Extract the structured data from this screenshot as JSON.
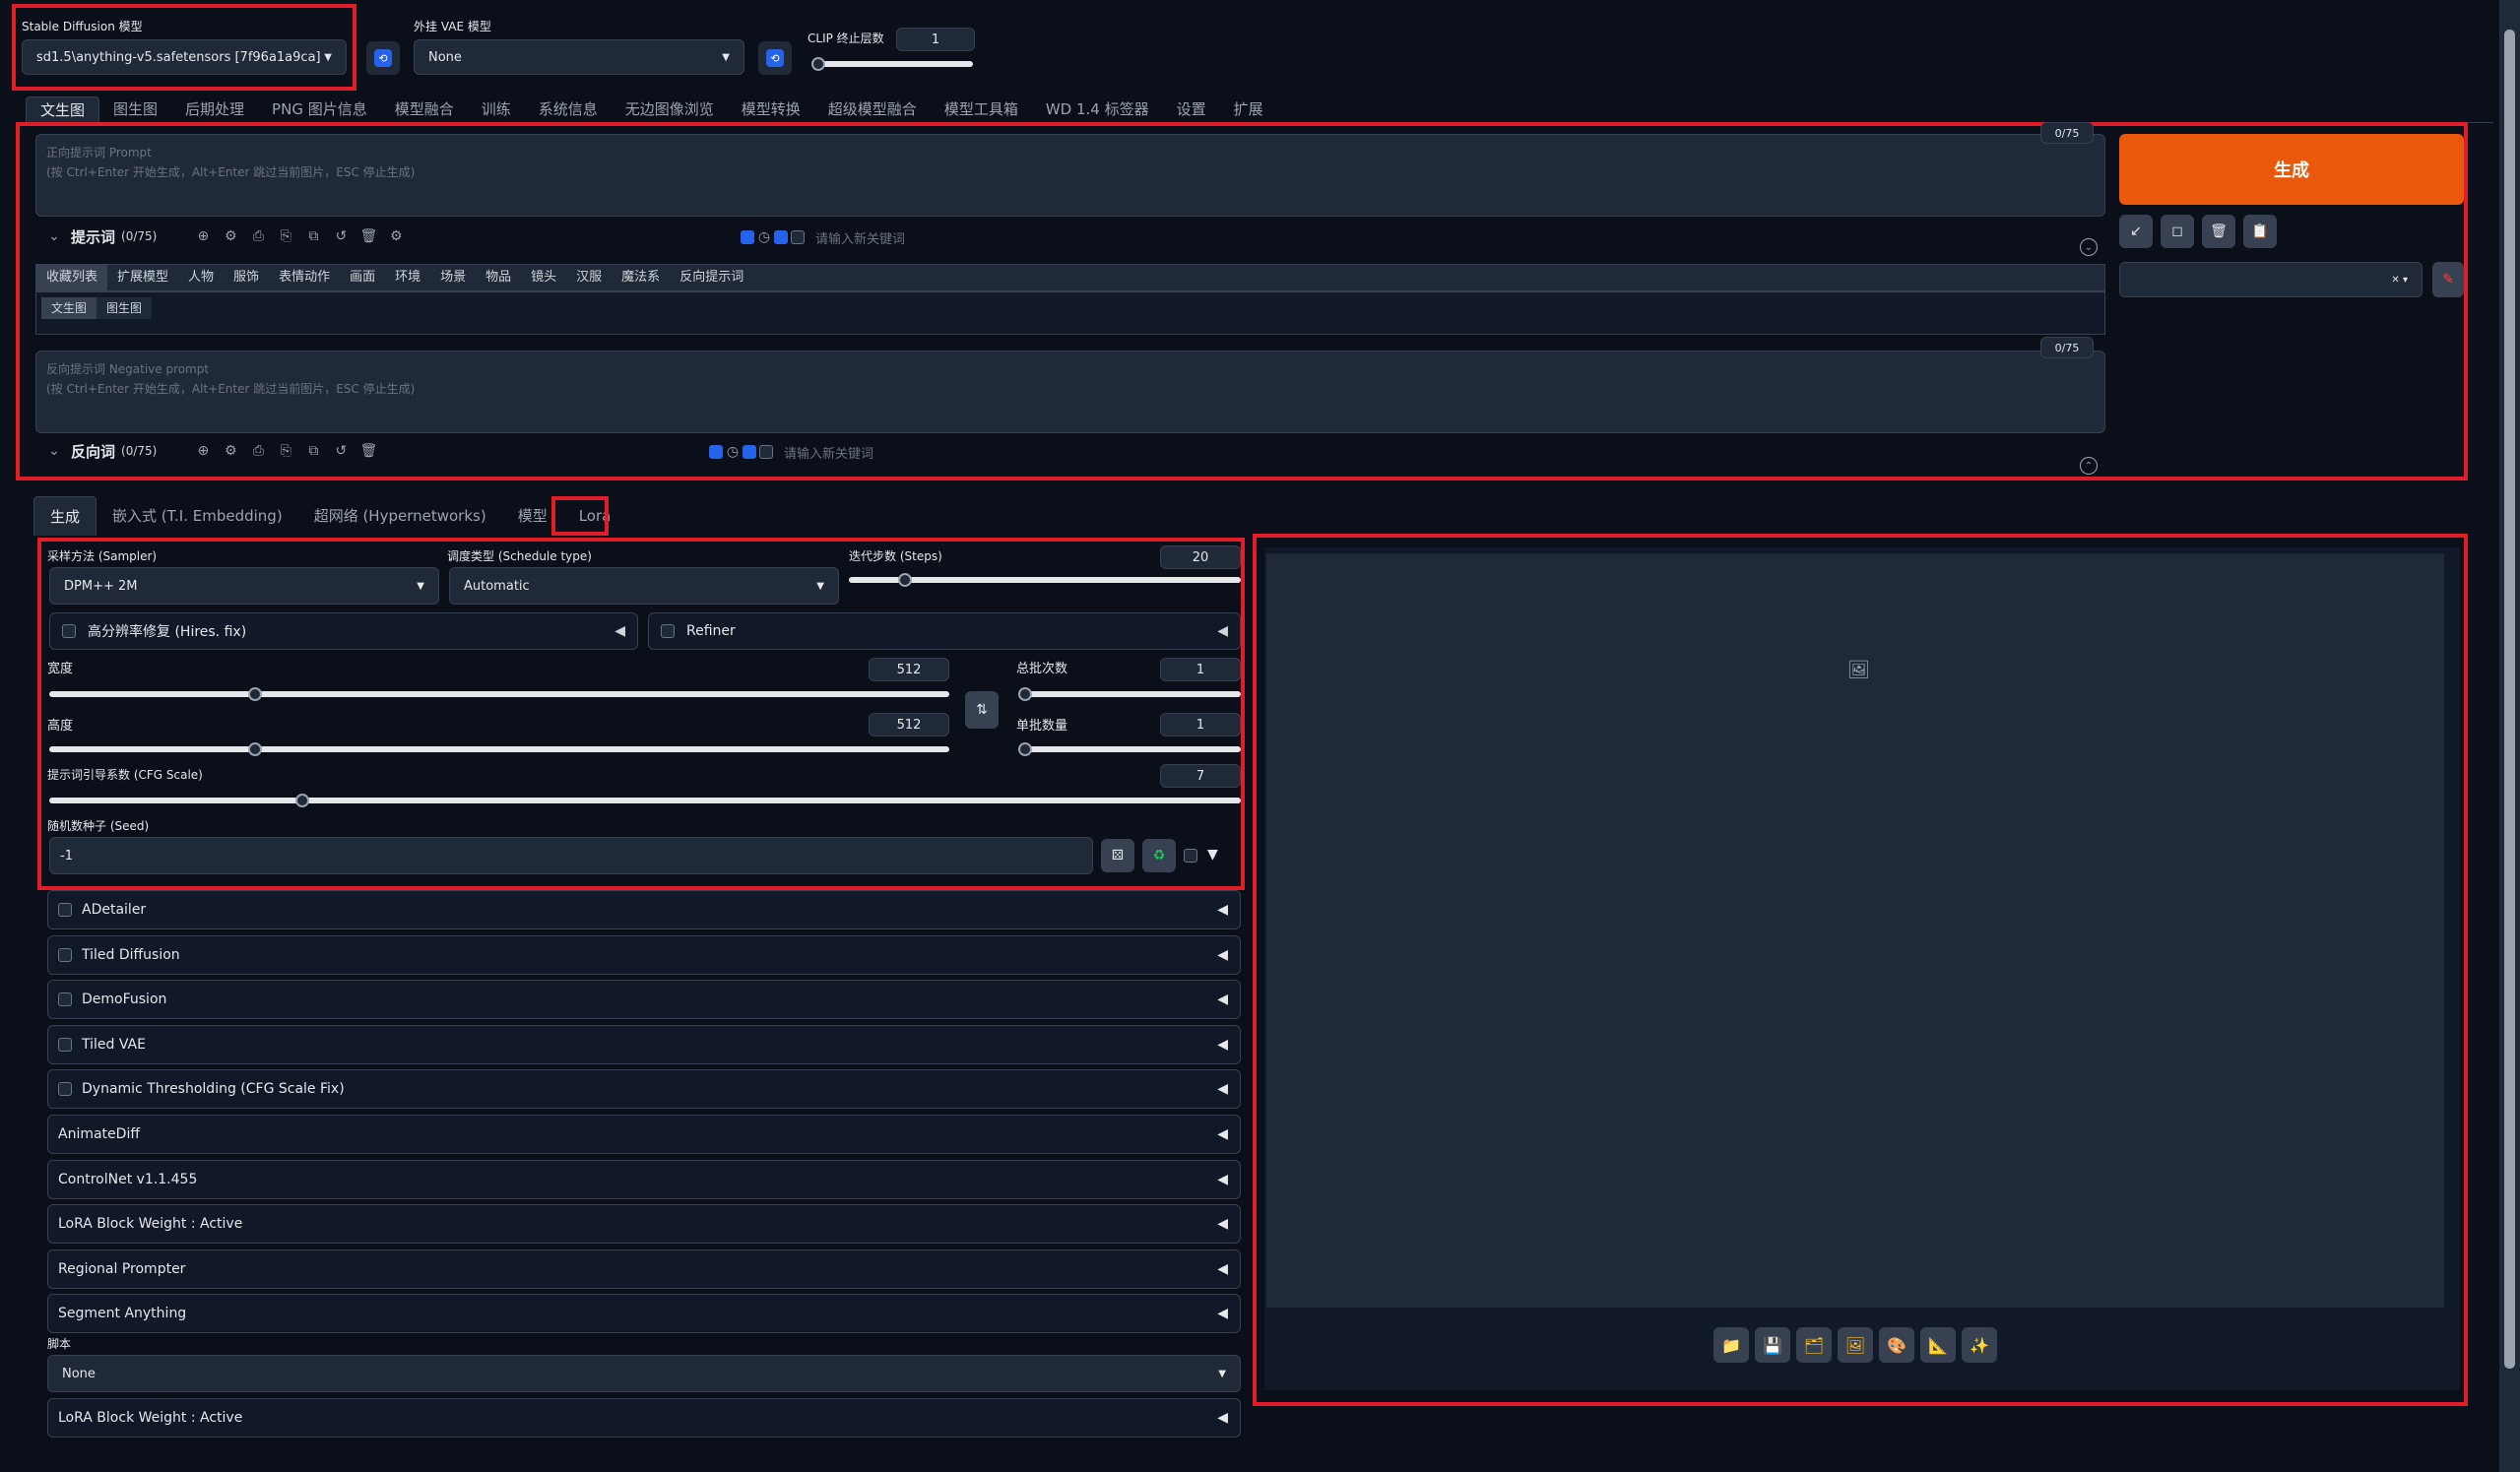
{
  "top": {
    "sd_model_label": "Stable Diffusion 模型",
    "sd_model_value": "sd1.5\\anything-v5.safetensors [7f96a1a9ca]",
    "vae_label": "外挂 VAE 模型",
    "vae_value": "None",
    "clip_label": "CLIP 终止层数",
    "clip_value": "1"
  },
  "main_tabs": [
    "文生图",
    "图生图",
    "后期处理",
    "PNG 图片信息",
    "模型融合",
    "训练",
    "系统信息",
    "无边图像浏览",
    "模型转换",
    "超级模型融合",
    "模型工具箱",
    "WD 1.4 标签器",
    "设置",
    "扩展"
  ],
  "prompt": {
    "counter": "0/75",
    "placeholder_line1": "正向提示词 Prompt",
    "placeholder_line2": "(按 Ctrl+Enter 开始生成，Alt+Enter 跳过当前图片，ESC 停止生成)",
    "toolbar_label": "提示词",
    "toolbar_count": "(0/75)",
    "keyword_placeholder": "请输入新关键词"
  },
  "categories": [
    "收藏列表",
    "扩展模型",
    "人物",
    "服饰",
    "表情动作",
    "画面",
    "环境",
    "场景",
    "物品",
    "镜头",
    "汉服",
    "魔法系",
    "反向提示词"
  ],
  "sub_tabs": [
    "文生图",
    "图生图"
  ],
  "negative": {
    "counter": "0/75",
    "placeholder_line1": "反向提示词 Negative prompt",
    "placeholder_line2": "(按 Ctrl+Enter 开始生成，Alt+Enter 跳过当前图片，ESC 停止生成)",
    "toolbar_label": "反向词",
    "toolbar_count": "(0/75)",
    "keyword_placeholder": "请输入新关键词"
  },
  "generate_label": "生成",
  "gen_tabs": [
    "生成",
    "嵌入式 (T.I. Embedding)",
    "超网络 (Hypernetworks)",
    "模型",
    "Lora"
  ],
  "params": {
    "sampler_label": "采样方法 (Sampler)",
    "sampler_value": "DPM++ 2M",
    "schedule_label": "调度类型 (Schedule type)",
    "schedule_value": "Automatic",
    "steps_label": "迭代步数 (Steps)",
    "steps_value": "20",
    "hires_label": "高分辨率修复 (Hires. fix)",
    "refiner_label": "Refiner",
    "width_label": "宽度",
    "width_value": "512",
    "height_label": "高度",
    "height_value": "512",
    "batch_count_label": "总批次数",
    "batch_count_value": "1",
    "batch_size_label": "单批数量",
    "batch_size_value": "1",
    "cfg_label": "提示词引导系数 (CFG Scale)",
    "cfg_value": "7",
    "seed_label": "随机数种子 (Seed)",
    "seed_value": "-1"
  },
  "accordions": [
    "ADetailer",
    "Tiled Diffusion",
    "DemoFusion",
    "Tiled VAE",
    "Dynamic Thresholding (CFG Scale Fix)",
    "AnimateDiff",
    "ControlNet v1.1.455",
    "LoRA Block Weight : Active",
    "Regional Prompter",
    "Segment Anything"
  ],
  "script_label": "脚本",
  "script_value": "None",
  "last_accordion": "LoRA Block Weight : Active"
}
